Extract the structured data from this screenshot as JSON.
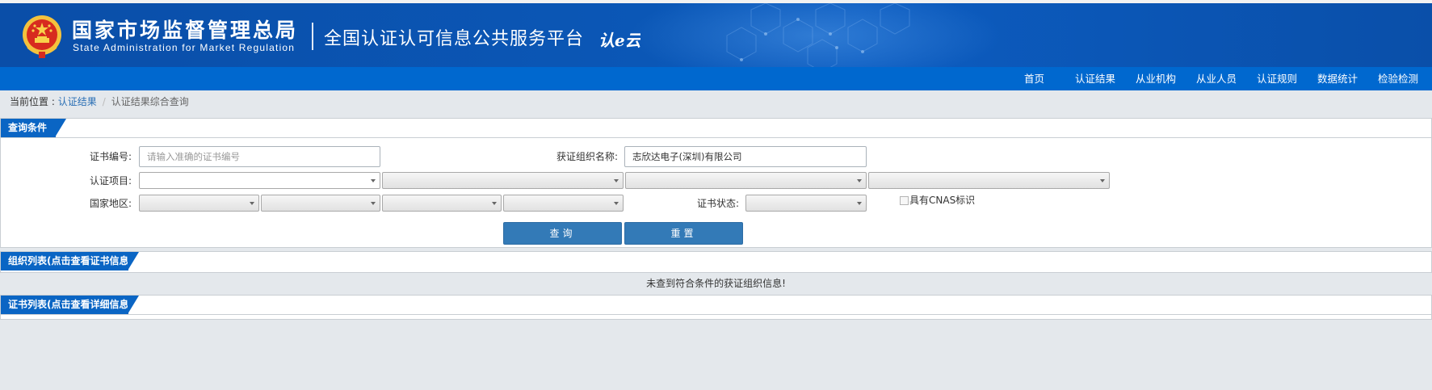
{
  "header": {
    "org_name_cn": "国家市场监督管理总局",
    "org_name_en": "State Administration for Market Regulation",
    "platform_title": "全国认证认可信息公共服务平台",
    "platform_logo_text": "认e云"
  },
  "nav": {
    "items": [
      "首页",
      "认证结果",
      "从业机构",
      "从业人员",
      "认证规则",
      "数据统计",
      "检验检测"
    ]
  },
  "breadcrumb": {
    "prefix": "当前位置 : ",
    "link": "认证结果",
    "separator": "/",
    "current": "认证结果综合查询"
  },
  "query_panel": {
    "title": "查询条件",
    "cert_no_label": "证书编号:",
    "cert_no_placeholder": "请输入准确的证书编号",
    "cert_no_value": "",
    "org_name_label": "获证组织名称:",
    "org_name_value": "志欣达电子(深圳)有限公司",
    "project_label": "认证项目:",
    "region_label": "国家地区:",
    "status_label": "证书状态:",
    "cnas_label": "具有CNAS标识",
    "search_button": "查询",
    "reset_button": "重置"
  },
  "org_panel": {
    "title": "组织列表(点击查看证书信息)",
    "empty_message": "未查到符合条件的获证组织信息!"
  },
  "cert_panel": {
    "title": "证书列表(点击查看详细信息)"
  },
  "colors": {
    "banner": "#0b57b6",
    "nav": "#0068cf",
    "tab": "#0a65c4",
    "button": "#337ab7",
    "link": "#2a6fb5",
    "page_bg": "#e4e8ec"
  }
}
